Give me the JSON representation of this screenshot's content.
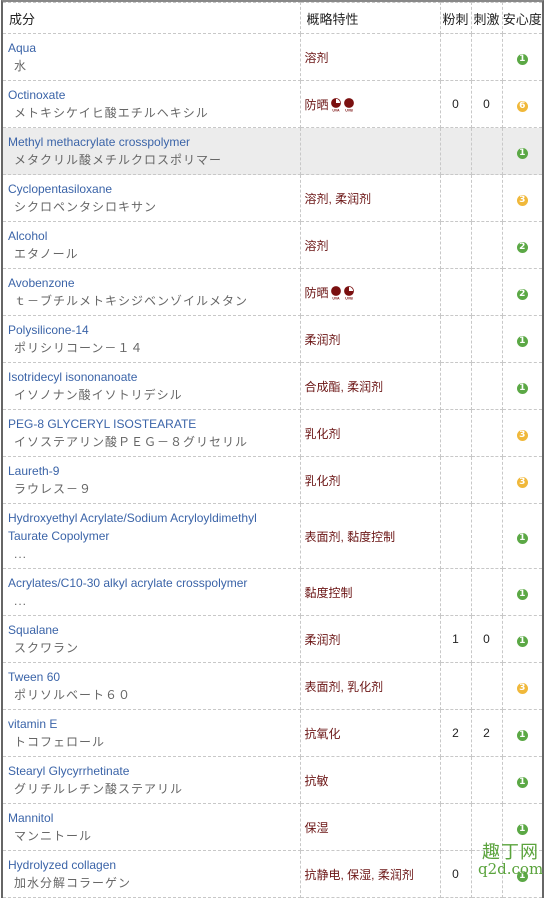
{
  "header": {
    "ingredient": "成分",
    "property": "概略特性",
    "acne": "粉刺",
    "irritation": "刺激",
    "safety": "安心度"
  },
  "colors": {
    "safety_green": "#5ba845",
    "safety_yellow": "#f0b83a",
    "link_blue": "#3b64a8",
    "property_text": "#6b1515",
    "highlight_row": "#ececec"
  },
  "rows": [
    {
      "en": "Aqua",
      "jp": "水",
      "property": "溶剂",
      "uv": [],
      "acne": "",
      "irritation": "",
      "safety": "1",
      "level": "green"
    },
    {
      "en": "Octinoxate",
      "jp": "メトキシケイヒ酸エチルヘキシル",
      "property": "防晒",
      "uv": [
        {
          "label": "UVA",
          "fill": "partial"
        },
        {
          "label": "UVB",
          "fill": "full"
        }
      ],
      "acne": "0",
      "irritation": "0",
      "safety": "6",
      "level": "yellow"
    },
    {
      "en": "Methyl methacrylate crosspolymer",
      "jp": "メタクリル酸メチルクロスポリマー",
      "property": "",
      "uv": [],
      "acne": "",
      "irritation": "",
      "safety": "1",
      "level": "green",
      "highlight": true
    },
    {
      "en": "Cyclopentasiloxane",
      "jp": "シクロペンタシロキサン",
      "property": "溶剂, 柔润剂",
      "uv": [],
      "acne": "",
      "irritation": "",
      "safety": "3",
      "level": "yellow"
    },
    {
      "en": "Alcohol",
      "jp": "エタノール",
      "property": "溶剂",
      "uv": [],
      "acne": "",
      "irritation": "",
      "safety": "2",
      "level": "green"
    },
    {
      "en": "Avobenzone",
      "jp": "ｔ－ブチルメトキシジベンゾイルメタン",
      "property": "防晒",
      "uv": [
        {
          "label": "UVA",
          "fill": "full"
        },
        {
          "label": "UVB",
          "fill": "partial"
        }
      ],
      "acne": "",
      "irritation": "",
      "safety": "2",
      "level": "green"
    },
    {
      "en": "Polysilicone-14",
      "jp": "ポリシリコーン－１４",
      "property": "柔润剂",
      "uv": [],
      "acne": "",
      "irritation": "",
      "safety": "1",
      "level": "green"
    },
    {
      "en": "Isotridecyl isononanoate",
      "jp": "イソノナン酸イソトリデシル",
      "property": "合成酯, 柔润剂",
      "uv": [],
      "acne": "",
      "irritation": "",
      "safety": "1",
      "level": "green"
    },
    {
      "en": "PEG-8 GLYCERYL ISOSTEARATE",
      "jp": "イソステアリン酸ＰＥＧ－８グリセリル",
      "property": "乳化剂",
      "uv": [],
      "acne": "",
      "irritation": "",
      "safety": "3",
      "level": "yellow"
    },
    {
      "en": "Laureth-9",
      "jp": "ラウレス－９",
      "property": "乳化剂",
      "uv": [],
      "acne": "",
      "irritation": "",
      "safety": "3",
      "level": "yellow"
    },
    {
      "en": "Hydroxyethyl Acrylate/Sodium Acryloyldimethyl Taurate Copolymer",
      "jp": "...",
      "property": "表面剂, 黏度控制",
      "uv": [],
      "acne": "",
      "irritation": "",
      "safety": "1",
      "level": "green"
    },
    {
      "en": "Acrylates/C10-30 alkyl acrylate crosspolymer",
      "jp": "...",
      "property": "黏度控制",
      "uv": [],
      "acne": "",
      "irritation": "",
      "safety": "1",
      "level": "green"
    },
    {
      "en": "Squalane",
      "jp": "スクワラン",
      "property": "柔润剂",
      "uv": [],
      "acne": "1",
      "irritation": "0",
      "safety": "1",
      "level": "green"
    },
    {
      "en": "Tween 60",
      "jp": "ポリソルベート６０",
      "property": "表面剂, 乳化剂",
      "uv": [],
      "acne": "",
      "irritation": "",
      "safety": "3",
      "level": "yellow"
    },
    {
      "en": "vitamin E",
      "jp": "トコフェロール",
      "property": "抗氧化",
      "uv": [],
      "acne": "2",
      "irritation": "2",
      "safety": "1",
      "level": "green"
    },
    {
      "en": "Stearyl Glycyrrhetinate",
      "jp": "グリチルレチン酸ステアリル",
      "property": "抗敏",
      "uv": [],
      "acne": "",
      "irritation": "",
      "safety": "1",
      "level": "green"
    },
    {
      "en": "Mannitol",
      "jp": "マンニトール",
      "property": "保湿",
      "uv": [],
      "acne": "",
      "irritation": "",
      "safety": "1",
      "level": "green"
    },
    {
      "en": "Hydrolyzed collagen",
      "jp": "加水分解コラーゲン",
      "property": "抗静电, 保湿, 柔润剂",
      "uv": [],
      "acne": "0",
      "irritation": "",
      "safety": "1",
      "level": "green"
    }
  ],
  "watermark": {
    "line1": "趣丁网",
    "line2": "q2d.com"
  }
}
